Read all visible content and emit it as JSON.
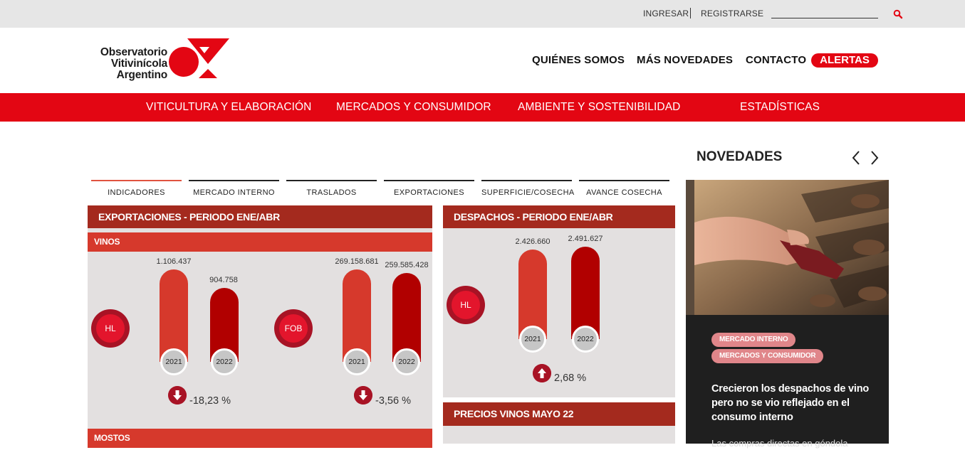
{
  "topbar": {
    "login": "INGRESAR",
    "register": "REGISTRARSE",
    "search_placeholder": ""
  },
  "logo": {
    "line1": "Observatorio",
    "line2": "Vitivinícola",
    "line3": "Argentino",
    "color": "#e30613"
  },
  "main_nav": {
    "about": "QUIÉNES SOMOS",
    "news": "MÁS NOVEDADES",
    "contact": "CONTACTO",
    "alerts": "ALERTAS"
  },
  "categories": [
    "VITICULTURA Y ELABORACIÓN",
    "MERCADOS Y CONSUMIDOR",
    "AMBIENTE Y SOSTENIBILIDAD",
    "ESTADÍSTICAS"
  ],
  "tabs": [
    "INDICADORES",
    "MERCADO INTERNO",
    "TRASLADOS",
    "EXPORTACIONES",
    "SUPERFICIE/COSECHA",
    "AVANCE COSECHA"
  ],
  "exports_panel": {
    "title": "EXPORTACIONES - PERIODO ENE/ABR",
    "wines_label": "VINOS",
    "musts_label": "MOSTOS",
    "hl": {
      "unit": "HL",
      "values": [
        {
          "year": "2021",
          "label": "1.106.437",
          "value": 1106437
        },
        {
          "year": "2022",
          "label": "904.758",
          "value": 904758
        }
      ],
      "direction": "down",
      "change": "-18,23 %"
    },
    "fob": {
      "unit": "FOB",
      "values": [
        {
          "year": "2021",
          "label": "269.158.681",
          "value": 269158681
        },
        {
          "year": "2022",
          "label": "259.585.428",
          "value": 259585428
        }
      ],
      "direction": "down",
      "change": "-3,56 %"
    }
  },
  "dispatch_panel": {
    "title": "DESPACHOS - PERIODO ENE/ABR",
    "hl": {
      "unit": "HL",
      "values": [
        {
          "year": "2021",
          "label": "2.426.660",
          "value": 2426660
        },
        {
          "year": "2022",
          "label": "2.491.627",
          "value": 2491627
        }
      ],
      "direction": "up",
      "change": "2,68 %"
    }
  },
  "prices_panel": {
    "title": "PRECIOS VINOS MAYO 22"
  },
  "novedades": {
    "title": "NOVEDADES",
    "badges": [
      "MERCADO INTERNO",
      "MERCADOS Y CONSUMIDOR"
    ],
    "headline": "Crecieron los despachos de vino pero no se vio reflejado en el consumo interno",
    "excerpt": "Las compras directas en góndola"
  },
  "colors": {
    "brand_red": "#e30613",
    "panel_dark": "#a42a1e",
    "bar_2021": "#d6392c",
    "bar_2022": "#b10000",
    "badge": "#e0868a"
  }
}
